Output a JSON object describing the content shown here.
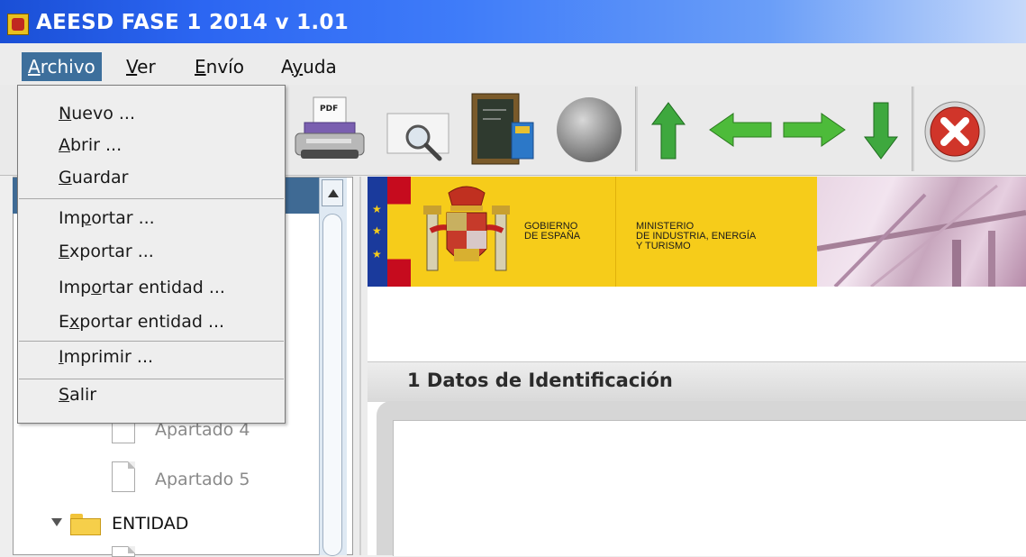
{
  "window": {
    "title": "AEESD FASE 1 2014  v 1.01"
  },
  "menubar": {
    "items": [
      {
        "label": "Archivo",
        "mnemonic": "A",
        "active": true
      },
      {
        "label": "Ver",
        "mnemonic": "V"
      },
      {
        "label": "Envío",
        "mnemonic": "E"
      },
      {
        "label": "Ayuda",
        "mnemonic": "y"
      }
    ]
  },
  "archivo_menu": {
    "groups": [
      [
        "Nuevo ...",
        "Abrir ...",
        "Guardar"
      ],
      [
        "Importar ...",
        "Exportar ...",
        "Importar entidad ...",
        "Exportar entidad ..."
      ],
      [
        "Imprimir ..."
      ],
      [
        "Salir"
      ]
    ],
    "items": [
      {
        "label": "Nuevo ...",
        "mnemonic": "N"
      },
      {
        "label": "Abrir ...",
        "mnemonic": "A"
      },
      {
        "label": "Guardar",
        "mnemonic": "G"
      },
      {
        "label": "Importar ...",
        "mnemonic": "p"
      },
      {
        "label": "Exportar ...",
        "mnemonic": "E"
      },
      {
        "label": "Importar entidad ...",
        "mnemonic": "o"
      },
      {
        "label": "Exportar entidad ...",
        "mnemonic": "x"
      },
      {
        "label": "Imprimir ...",
        "mnemonic": "I"
      },
      {
        "label": "Salir",
        "mnemonic": "S"
      }
    ]
  },
  "toolbar": {
    "buttons": [
      {
        "icon": "pdf-printer-icon",
        "badge": "PDF"
      },
      {
        "icon": "preview-magnifier-icon"
      },
      {
        "icon": "calculator-notebook-icon"
      },
      {
        "icon": "globe-icon",
        "disabled": true
      },
      {
        "icon": "arrow-up-icon"
      },
      {
        "icon": "arrow-left-icon"
      },
      {
        "icon": "arrow-right-icon"
      },
      {
        "icon": "arrow-down-icon"
      },
      {
        "icon": "exit-icon"
      }
    ]
  },
  "tree": {
    "items": [
      {
        "label": "Apartado 4",
        "type": "document"
      },
      {
        "label": "Apartado 5",
        "type": "document"
      },
      {
        "label": "ENTIDAD",
        "type": "folder",
        "expanded": true
      }
    ]
  },
  "banner": {
    "left_text": [
      "GOBIERNO",
      "DE ESPAÑA"
    ],
    "right_text": [
      "MINISTERIO",
      "DE INDUSTRIA, ENERGÍA",
      "Y TURISMO"
    ]
  },
  "section": {
    "title": "1 Datos de Identificación"
  },
  "colors": {
    "title_bar": "#2c66f2",
    "menu_selection": "#3d6f9c",
    "tree_selection": "#3f6a94",
    "banner_yellow": "#f6cc1a",
    "flag_red": "#c60b1e"
  }
}
